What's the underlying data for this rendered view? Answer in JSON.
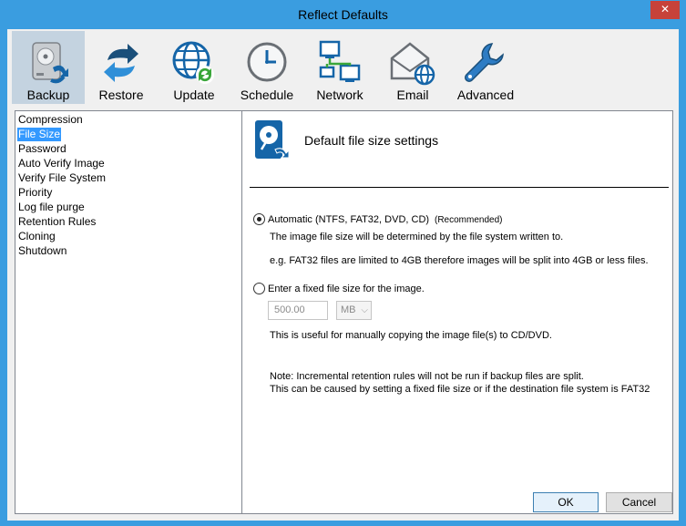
{
  "window": {
    "title": "Reflect Defaults",
    "close_glyph": "✕"
  },
  "toolbar": {
    "items": [
      {
        "label": "Backup",
        "icon": "backup-disk-icon",
        "active": true
      },
      {
        "label": "Restore",
        "icon": "restore-arrows-icon"
      },
      {
        "label": "Update",
        "icon": "globe-update-icon"
      },
      {
        "label": "Schedule",
        "icon": "clock-icon"
      },
      {
        "label": "Network",
        "icon": "network-computers-icon"
      },
      {
        "label": "Email",
        "icon": "email-globe-icon"
      },
      {
        "label": "Advanced",
        "icon": "wrench-icon"
      }
    ]
  },
  "sidebar": {
    "items": [
      {
        "label": "Compression"
      },
      {
        "label": "File Size",
        "selected": true
      },
      {
        "label": "Password"
      },
      {
        "label": "Auto Verify Image"
      },
      {
        "label": "Verify File System"
      },
      {
        "label": "Priority"
      },
      {
        "label": "Log file purge"
      },
      {
        "label": "Retention Rules"
      },
      {
        "label": "Cloning"
      },
      {
        "label": "Shutdown"
      }
    ]
  },
  "panel": {
    "title": "Default file size settings",
    "icon": "disk-backup-icon",
    "auto_option": {
      "label": "Automatic (NTFS, FAT32, DVD, CD)",
      "badge": "(Recommended)",
      "selected": true,
      "desc1": "The image file size will be determined by the file system written to.",
      "desc2": "e.g. FAT32 files are limited to 4GB therefore images will be split into 4GB or less files."
    },
    "fixed_option": {
      "label": "Enter a fixed file size for the image.",
      "selected": false,
      "size_value": "500.00",
      "unit_value": "MB",
      "desc": "This is useful for manually copying the image file(s) to CD/DVD."
    },
    "note1": "Note: Incremental retention rules will not be run if backup files are split.",
    "note2": "This can be caused by setting a fixed file size or if the destination file system is FAT32"
  },
  "buttons": {
    "ok": "OK",
    "cancel": "Cancel"
  },
  "colors": {
    "titlebar": "#3a9de0",
    "selection": "#3399ff",
    "toolbar_active": "#c4d3e0",
    "close_button": "#c7423a"
  }
}
